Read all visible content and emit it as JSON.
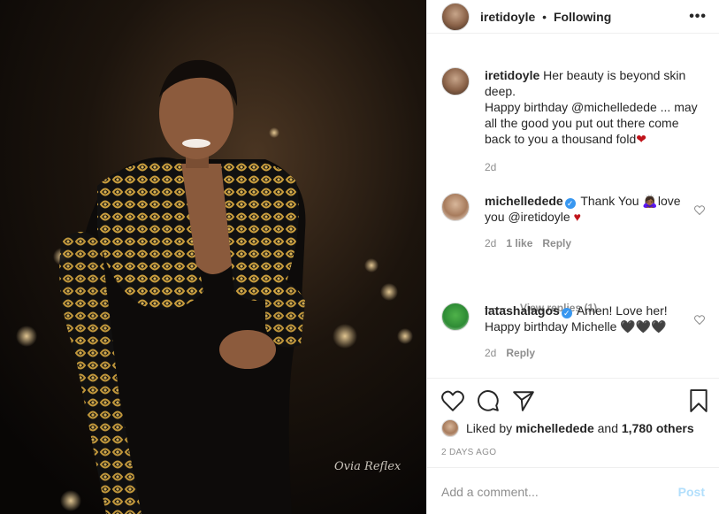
{
  "photo": {
    "watermark": "Ovia Reflex"
  },
  "header": {
    "username": "iretidoyle",
    "separator": "•",
    "follow_status": "Following",
    "more_icon": "ellipsis-icon"
  },
  "comments": [
    {
      "username": "iretidoyle",
      "line1": "Her beauty is beyond skin deep.",
      "line2": "Happy birthday @michelledede ... may all the good you put out there come back to you a thousand fold",
      "emoji": "❤",
      "time": "2d"
    },
    {
      "username": "michelledede",
      "verified": true,
      "text": "Thank You 🙇🏾‍♀️love you @iretidoyle",
      "emoji": "♥",
      "time": "2d",
      "likes": "1 like",
      "reply": "Reply",
      "view_replies": "View replies (1)"
    },
    {
      "username": "latashalagos",
      "verified": true,
      "text": "Amen! Love her! Happy birthday Michelle",
      "emoji": "🖤🖤🖤",
      "time": "2d",
      "reply": "Reply"
    }
  ],
  "actions": {
    "icons": [
      "heart-icon",
      "comment-icon",
      "share-icon",
      "bookmark-icon"
    ],
    "liked_by_prefix": "Liked by",
    "liked_by_user": "michelledede",
    "liked_by_and": "and",
    "liked_by_others": "1,780 others",
    "date": "2 DAYS AGO",
    "add_comment_placeholder": "Add a comment...",
    "post_label": "Post"
  }
}
